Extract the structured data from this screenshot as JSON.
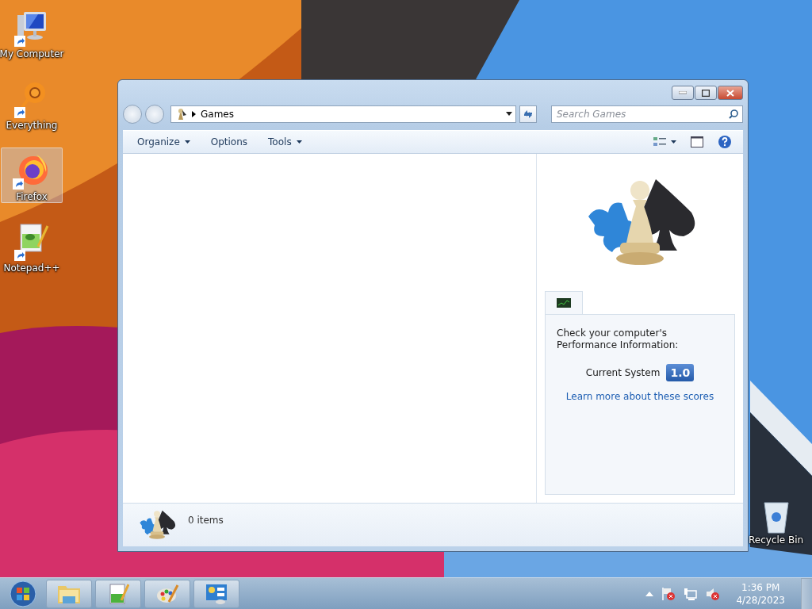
{
  "desktop_icons": [
    {
      "kind": "computer",
      "label": "My Computer",
      "selected": false
    },
    {
      "kind": "everything",
      "label": "Everything",
      "selected": false
    },
    {
      "kind": "firefox",
      "label": "Firefox",
      "selected": true
    },
    {
      "kind": "notepad",
      "label": "Notepad++",
      "selected": false
    }
  ],
  "recycle_bin": {
    "label": "Recycle Bin"
  },
  "window": {
    "address": {
      "crumbs": [
        "Games"
      ]
    },
    "search": {
      "placeholder": "Search Games"
    },
    "toolbar": [
      {
        "label": "Organize",
        "has_menu": true
      },
      {
        "label": "Options",
        "has_menu": false
      },
      {
        "label": "Tools",
        "has_menu": true
      }
    ],
    "details": {
      "message": "Check your computer's Performance Information:",
      "score_label": "Current System",
      "score": "1.0",
      "link": "Learn more about these scores"
    },
    "status": {
      "count": "0 items"
    }
  },
  "taskbar": {
    "apps": [
      {
        "kind": "explorer"
      },
      {
        "kind": "notepad"
      },
      {
        "kind": "paint"
      },
      {
        "kind": "panel"
      }
    ],
    "clock": {
      "time": "1:36 PM",
      "date": "4/28/2023"
    }
  }
}
